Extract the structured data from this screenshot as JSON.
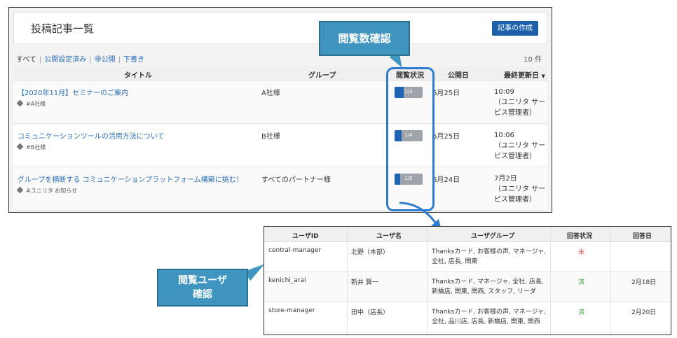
{
  "header": {
    "title": "投稿記事一覧",
    "create_button": "記事の作成"
  },
  "filters": {
    "all": "すべて",
    "published": "公開設定済み",
    "unpublished": "非公開",
    "draft": "下書き",
    "count": "10 件"
  },
  "columns": {
    "title": "タイトル",
    "group": "グループ",
    "status": "閲覧状況",
    "published": "公開日",
    "updated": "最終更新日"
  },
  "sort_icon": "triangle-down-icon",
  "articles": [
    {
      "title": "【2020年11月】セミナーのご案内",
      "tag": "#A社様",
      "group": "A社様",
      "progress": 0.333,
      "status": "1/3",
      "date": "6月25日",
      "updated": "10:09\n（ユニリタ サービス管理者）"
    },
    {
      "title": "コミュニケーションツールの活用方法について",
      "tag": "#B社様",
      "group": "B社様",
      "progress": 0.25,
      "status": "1/4",
      "date": "6月25日",
      "updated": "10:06\n（ユニリタ サービス管理者）"
    },
    {
      "title": "グループを横断する コミュニケーションプラットフォーム構築に挑む！",
      "tag": "#ユニリタ お知らせ",
      "group": "すべてのパートナー様",
      "progress": 0.2,
      "status": "1/5",
      "date": "6月24日",
      "updated": "7月2日\n（ユニリタ サービス管理者）"
    }
  ],
  "callouts": {
    "view_count": "閲覧数確認",
    "view_users_line1": "閲覧ユーザ",
    "view_users_line2": "確認"
  },
  "readers": {
    "columns": {
      "id": "ユーザID",
      "name": "ユーザ名",
      "group": "ユーザグループ",
      "status": "回答状況",
      "date": "回答日"
    },
    "rows": [
      {
        "id": "central-manager",
        "name": "北野（本部）",
        "group": "Thanksカード, お客様の声, マネージャ, 全社, 店長, 関東",
        "status": "未",
        "answered": false,
        "date": ""
      },
      {
        "id": "kenichi_arai",
        "name": "新井 賢一",
        "group": "Thanksカード, マネージャ, 全社, 店長, 新橋店, 関東, 関西, スタッフ, リーダ",
        "status": "済",
        "answered": true,
        "date": "2月18日"
      },
      {
        "id": "store-manager",
        "name": "田中（店長）",
        "group": "Thanksカード, お客様の声, マネージャ, 全社, 品川店, 店長, 新橋店, 関東, 関西",
        "status": "済",
        "answered": true,
        "date": "2月20日"
      }
    ]
  },
  "colors": {
    "accent": "#1d5fa8",
    "callout": "#3f94c0",
    "highlight": "#2f7ccf",
    "pending": "#d9534f",
    "done": "#3aa13a"
  }
}
